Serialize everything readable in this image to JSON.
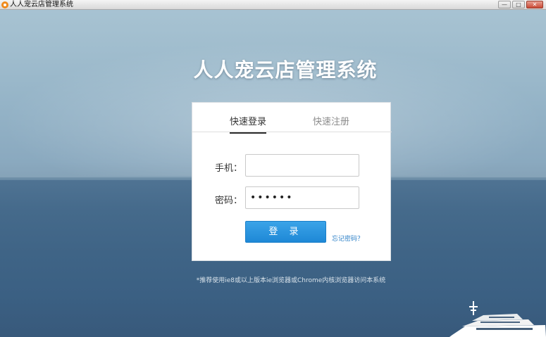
{
  "window": {
    "title": "人人宠云店管理系统",
    "controls": [
      "minimize",
      "maximize",
      "close"
    ]
  },
  "page": {
    "heading": "人人宠云店管理系统",
    "hint": "*推荐使用ie8或以上版本ie浏览器或Chrome内核浏览器访问本系统"
  },
  "login": {
    "tabs": [
      {
        "label": "快速登录",
        "active": true
      },
      {
        "label": "快速注册",
        "active": false
      }
    ],
    "phone_label": "手机：",
    "phone_value": "",
    "password_label": "密码：",
    "password_value": "••••••",
    "submit_label": "登 录",
    "forgot_label": "忘记密码？"
  },
  "colors": {
    "accent": "#2b8fdc",
    "link": "#2b7fc7",
    "app_icon": "#f08a1c"
  }
}
